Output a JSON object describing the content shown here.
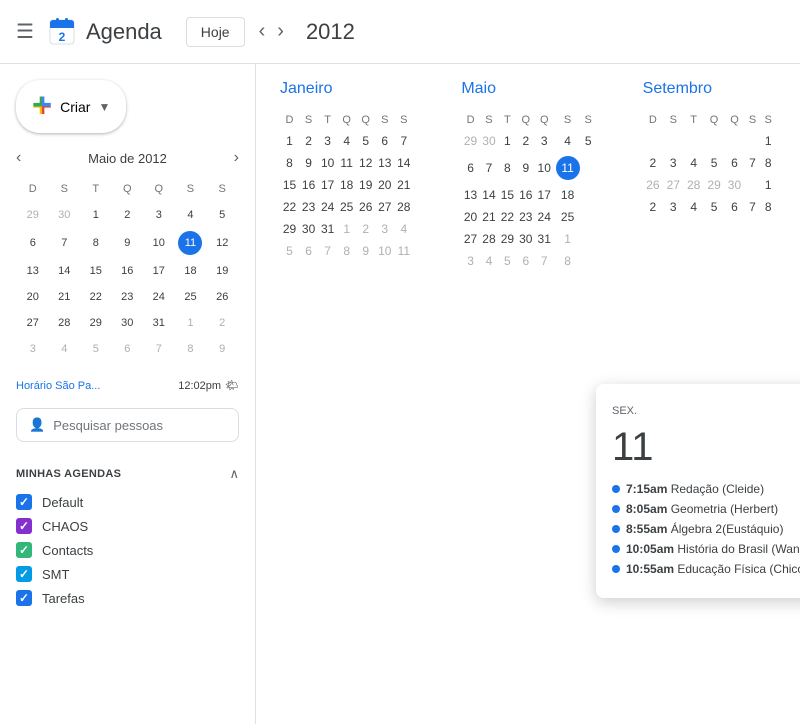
{
  "header": {
    "menu_icon": "☰",
    "logo_colors": [
      "#4285f4",
      "#ea4335",
      "#fbbc04",
      "#34a853"
    ],
    "title": "Agenda",
    "today_label": "Hoje",
    "prev_icon": "‹",
    "next_icon": "›",
    "year": "2012"
  },
  "sidebar": {
    "create_label": "Criar",
    "mini_cal": {
      "title": "Maio de 2012",
      "prev_icon": "‹",
      "next_icon": "›",
      "day_headers": [
        "D",
        "S",
        "T",
        "Q",
        "Q",
        "S",
        "S"
      ],
      "weeks": [
        [
          {
            "day": "29",
            "outside": true
          },
          {
            "day": "30",
            "outside": true
          },
          {
            "day": "1"
          },
          {
            "day": "2"
          },
          {
            "day": "3"
          },
          {
            "day": "4"
          },
          {
            "day": "5"
          }
        ],
        [
          {
            "day": "6"
          },
          {
            "day": "7"
          },
          {
            "day": "8"
          },
          {
            "day": "9"
          },
          {
            "day": "10"
          },
          {
            "day": "11",
            "today": true
          },
          {
            "day": "12"
          }
        ],
        [
          {
            "day": "13"
          },
          {
            "day": "14"
          },
          {
            "day": "15"
          },
          {
            "day": "16"
          },
          {
            "day": "17"
          },
          {
            "day": "18"
          },
          {
            "day": "19"
          }
        ],
        [
          {
            "day": "20"
          },
          {
            "day": "21"
          },
          {
            "day": "22"
          },
          {
            "day": "23"
          },
          {
            "day": "24"
          },
          {
            "day": "25"
          },
          {
            "day": "26"
          }
        ],
        [
          {
            "day": "27"
          },
          {
            "day": "28"
          },
          {
            "day": "29"
          },
          {
            "day": "30"
          },
          {
            "day": "31"
          },
          {
            "day": "1",
            "outside": true
          },
          {
            "day": "2",
            "outside": true
          }
        ],
        [
          {
            "day": "3",
            "outside": true
          },
          {
            "day": "4",
            "outside": true
          },
          {
            "day": "5",
            "outside": true
          },
          {
            "day": "6",
            "outside": true
          },
          {
            "day": "7",
            "outside": true
          },
          {
            "day": "8",
            "outside": true
          },
          {
            "day": "9",
            "outside": true
          }
        ]
      ]
    },
    "timezone": {
      "text": "Horário São Pa...",
      "time": "12:02pm",
      "weather": "🌤"
    },
    "search_people": {
      "icon": "👤",
      "placeholder": "Pesquisar pessoas"
    },
    "my_calendars_title": "Minhas agendas",
    "calendars": [
      {
        "name": "Default",
        "color": "#1a73e8",
        "checked": true
      },
      {
        "name": "CHAOS",
        "color": "#8430ce",
        "checked": true
      },
      {
        "name": "Contacts",
        "color": "#33b679",
        "checked": true
      },
      {
        "name": "SMT",
        "color": "#039be5",
        "checked": true
      },
      {
        "name": "Tarefas",
        "color": "#1a73e8",
        "checked": true
      }
    ]
  },
  "main": {
    "year": "2012",
    "day_headers": [
      "D",
      "S",
      "T",
      "Q",
      "Q",
      "S",
      "S"
    ],
    "months": [
      {
        "name": "Janeiro",
        "weeks": [
          [
            {
              "d": "1"
            },
            {
              "d": "2"
            },
            {
              "d": "3"
            },
            {
              "d": "4"
            },
            {
              "d": "5"
            },
            {
              "d": "6"
            },
            {
              "d": "7"
            }
          ],
          [
            {
              "d": "8"
            },
            {
              "d": "9"
            },
            {
              "d": "10"
            },
            {
              "d": "11"
            },
            {
              "d": "12"
            },
            {
              "d": "13"
            },
            {
              "d": "14"
            }
          ],
          [
            {
              "d": "15"
            },
            {
              "d": "16"
            },
            {
              "d": "17"
            },
            {
              "d": "18"
            },
            {
              "d": "19"
            },
            {
              "d": "20"
            },
            {
              "d": "21"
            }
          ],
          [
            {
              "d": "22"
            },
            {
              "d": "23"
            },
            {
              "d": "24"
            },
            {
              "d": "25"
            },
            {
              "d": "26"
            },
            {
              "d": "27"
            },
            {
              "d": "28"
            }
          ],
          [
            {
              "d": "29"
            },
            {
              "d": "30"
            },
            {
              "d": "31"
            },
            {
              "d": "1",
              "out": true
            },
            {
              "d": "2",
              "out": true
            },
            {
              "d": "3",
              "out": true
            },
            {
              "d": "4",
              "out": true
            }
          ],
          [
            {
              "d": "5",
              "out": true
            },
            {
              "d": "6",
              "out": true
            },
            {
              "d": "7",
              "out": true
            },
            {
              "d": "8",
              "out": true
            },
            {
              "d": "9",
              "out": true
            },
            {
              "d": "10",
              "out": true
            },
            {
              "d": "11",
              "out": true
            }
          ]
        ]
      },
      {
        "name": "Maio",
        "weeks": [
          [
            {
              "d": "29",
              "out": true
            },
            {
              "d": "30",
              "out": true
            },
            {
              "d": "1"
            },
            {
              "d": "2"
            },
            {
              "d": "3"
            },
            {
              "d": "4"
            },
            {
              "d": "5"
            }
          ],
          [
            {
              "d": "6"
            },
            {
              "d": "7"
            },
            {
              "d": "8"
            },
            {
              "d": "9"
            },
            {
              "d": "10"
            },
            {
              "d": "11",
              "today": true
            },
            {
              "d": ""
            }
          ],
          [
            {
              "d": "13"
            },
            {
              "d": "14"
            },
            {
              "d": "15"
            },
            {
              "d": "16"
            },
            {
              "d": "17"
            },
            {
              "d": "18"
            },
            {
              "d": ""
            }
          ],
          [
            {
              "d": "20"
            },
            {
              "d": "21"
            },
            {
              "d": "22"
            },
            {
              "d": "23"
            },
            {
              "d": "24"
            },
            {
              "d": "25"
            },
            {
              "d": ""
            }
          ],
          [
            {
              "d": "27"
            },
            {
              "d": "28"
            },
            {
              "d": "29"
            },
            {
              "d": "30"
            },
            {
              "d": "31"
            },
            {
              "d": "1",
              "out": true
            },
            {
              "d": ""
            }
          ],
          [
            {
              "d": "3",
              "out": true
            },
            {
              "d": "4",
              "out": true
            },
            {
              "d": "5",
              "out": true
            },
            {
              "d": "6",
              "out": true
            },
            {
              "d": "7",
              "out": true
            },
            {
              "d": "8",
              "out": true
            },
            {
              "d": ""
            }
          ]
        ]
      },
      {
        "name": "Setembro",
        "weeks": [
          [
            {
              "d": ""
            },
            {
              "d": ""
            },
            {
              "d": ""
            },
            {
              "d": ""
            },
            {
              "d": ""
            },
            {
              "d": ""
            },
            {
              "d": "1"
            }
          ],
          [
            {
              "d": "2"
            },
            {
              "d": "3"
            },
            {
              "d": "4"
            },
            {
              "d": "5"
            },
            {
              "d": "6"
            },
            {
              "d": "7"
            },
            {
              "d": "8"
            }
          ],
          [
            {
              "d": "26",
              "out": true
            },
            {
              "d": "27",
              "out": true
            },
            {
              "d": "28",
              "out": true
            },
            {
              "d": "29",
              "out": true
            },
            {
              "d": "30",
              "out": true
            },
            {
              "d": ""
            },
            {
              "d": "1"
            }
          ],
          [
            {
              "d": "2"
            },
            {
              "d": "3"
            },
            {
              "d": "4"
            },
            {
              "d": "5"
            },
            {
              "d": "6"
            },
            {
              "d": "7"
            },
            {
              "d": "8"
            }
          ]
        ]
      }
    ],
    "popup": {
      "day_label": "SEX.",
      "day_number": "11",
      "close_icon": "✕",
      "events": [
        {
          "time": "7:15am",
          "title": "Redação (Cleide)"
        },
        {
          "time": "8:05am",
          "title": "Geometria (Herbert)"
        },
        {
          "time": "8:55am",
          "title": "Álgebra 2(Eustáquio)"
        },
        {
          "time": "10:05am",
          "title": "História do Brasil (Wan"
        },
        {
          "time": "10:55am",
          "title": "Educação Física (Chico"
        }
      ]
    }
  }
}
